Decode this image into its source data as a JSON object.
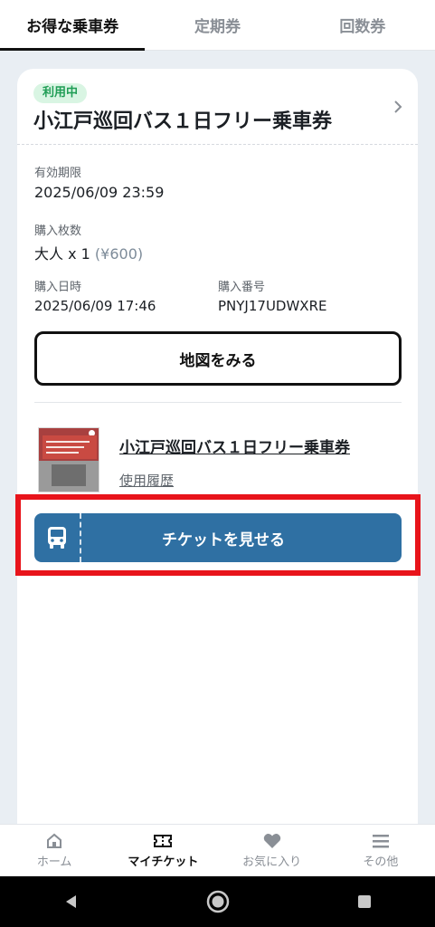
{
  "tabs": [
    {
      "label": "お得な乗車券",
      "active": true
    },
    {
      "label": "定期券",
      "active": false
    },
    {
      "label": "回数券",
      "active": false
    }
  ],
  "ticket": {
    "status_badge": "利用中",
    "title": "小江戸巡回バス１日フリー乗車券",
    "valid_until_label": "有効期限",
    "valid_until_value": "2025/06/09 23:59",
    "quantity_label": "購入枚数",
    "quantity_value": "大人 x 1",
    "price": "(¥600)",
    "purchase_date_label": "購入日時",
    "purchase_date_value": "2025/06/09 17:46",
    "purchase_number_label": "購入番号",
    "purchase_number_value": "PNYJ17UDWXRE",
    "map_button": "地図をみる",
    "product_link": "小江戸巡回バス１日フリー乗車券",
    "history_link": "使用履歴",
    "show_ticket_button": "チケットを見せる"
  },
  "bottom_nav": [
    {
      "label": "ホーム",
      "icon": "home-icon",
      "active": false
    },
    {
      "label": "マイチケット",
      "icon": "ticket-icon",
      "active": true
    },
    {
      "label": "お気に入り",
      "icon": "heart-icon",
      "active": false
    },
    {
      "label": "その他",
      "icon": "menu-icon",
      "active": false
    }
  ],
  "colors": {
    "accent_button": "#2f70a3",
    "badge_bg": "#d9f5e3",
    "badge_text": "#1f9d55",
    "highlight_border": "#e8141b"
  }
}
